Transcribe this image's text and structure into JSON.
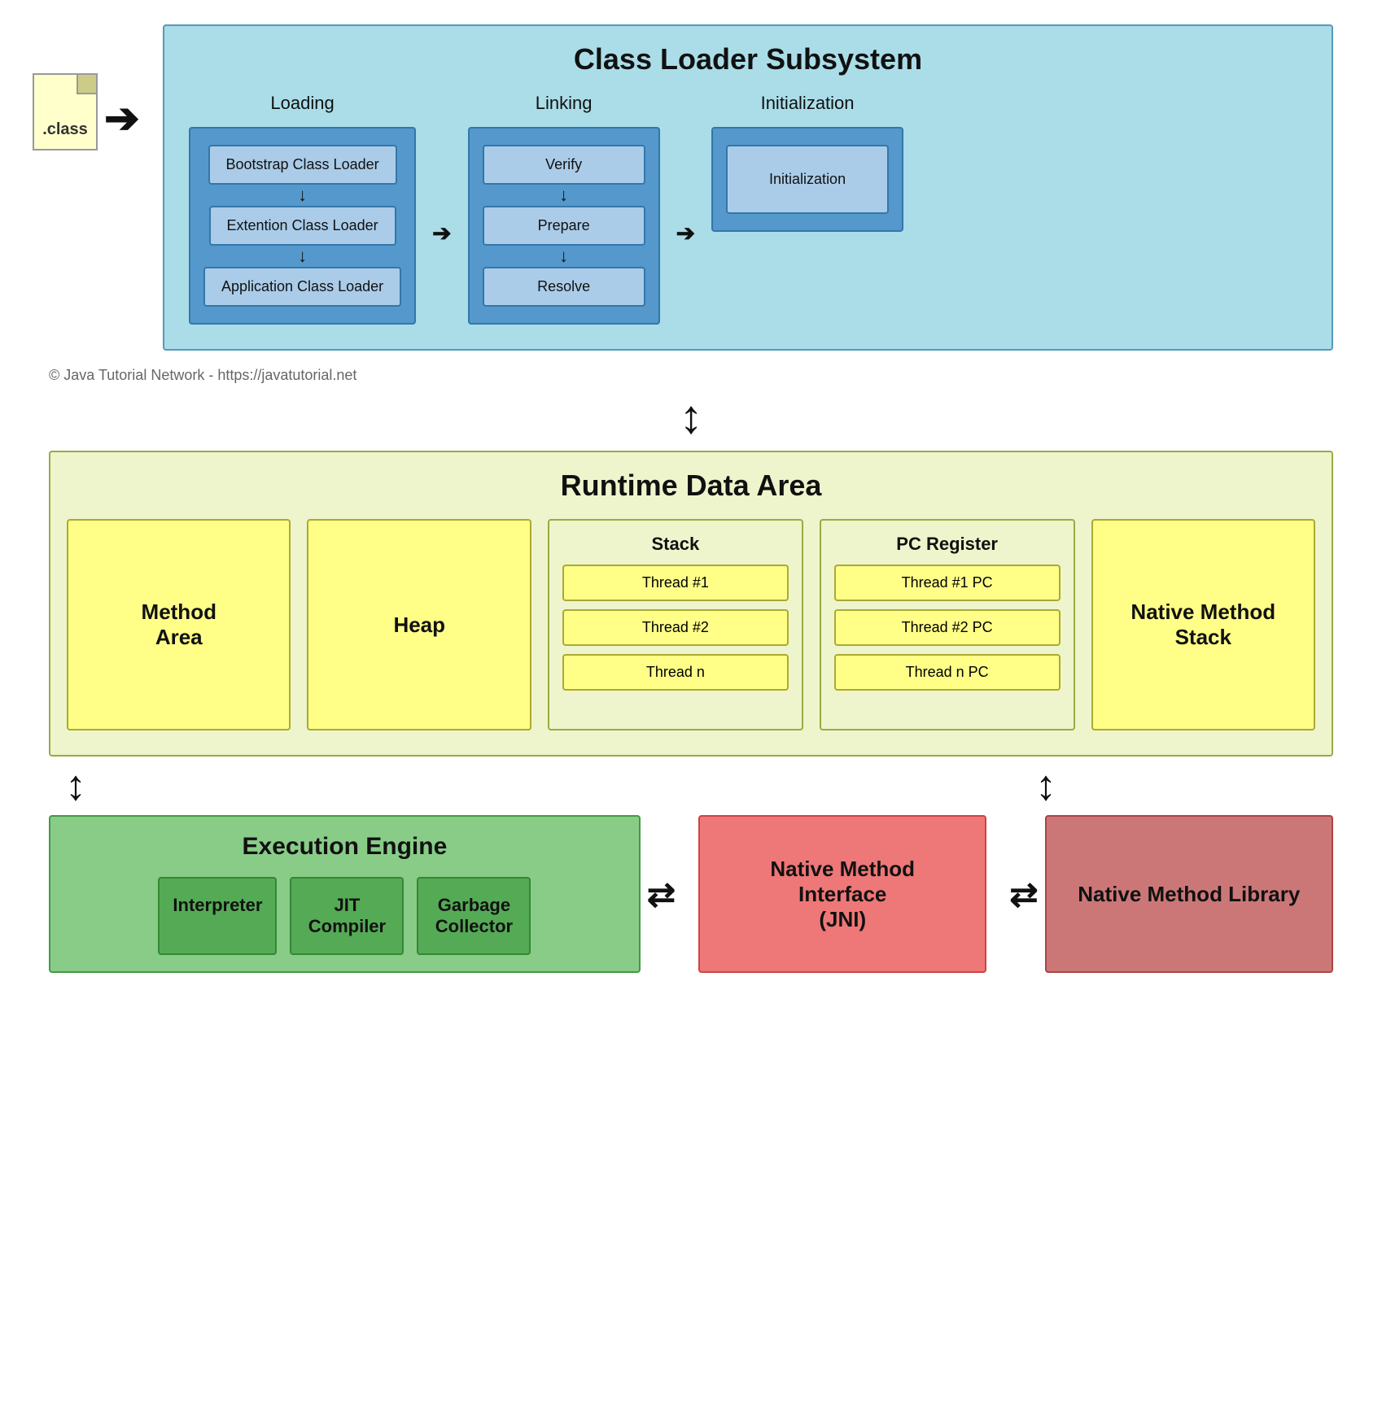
{
  "classLoaderSubsystem": {
    "title": "Class Loader Subsystem",
    "loading": {
      "label": "Loading",
      "items": [
        "Bootstrap Class Loader",
        "Extention Class Loader",
        "Application Class Loader"
      ]
    },
    "linking": {
      "label": "Linking",
      "items": [
        "Verify",
        "Prepare",
        "Resolve"
      ]
    },
    "initialization": {
      "label": "Initialization",
      "items": [
        "Initialization"
      ]
    }
  },
  "classFile": {
    "label": ".class"
  },
  "copyright": "© Java Tutorial Network - https://javatutorial.net",
  "runtimeDataArea": {
    "title": "Runtime Data Area",
    "methodArea": "Method\nArea",
    "heap": "Heap",
    "stack": {
      "label": "Stack",
      "threads": [
        "Thread #1",
        "Thread #2",
        "Thread n"
      ]
    },
    "pcRegister": {
      "label": "PC Register",
      "threads": [
        "Thread #1 PC",
        "Thread #2 PC",
        "Thread n PC"
      ]
    },
    "nativeMethodStack": "Native Method\nStack"
  },
  "executionEngine": {
    "title": "Execution Engine",
    "items": [
      "Interpreter",
      "JIT\nCompiler",
      "Garbage\nCollector"
    ]
  },
  "nativeMethodInterface": {
    "title": "Native Method\nInterface\n(JNI)"
  },
  "nativeMethodLibrary": {
    "title": "Native Method\nLibrary"
  }
}
